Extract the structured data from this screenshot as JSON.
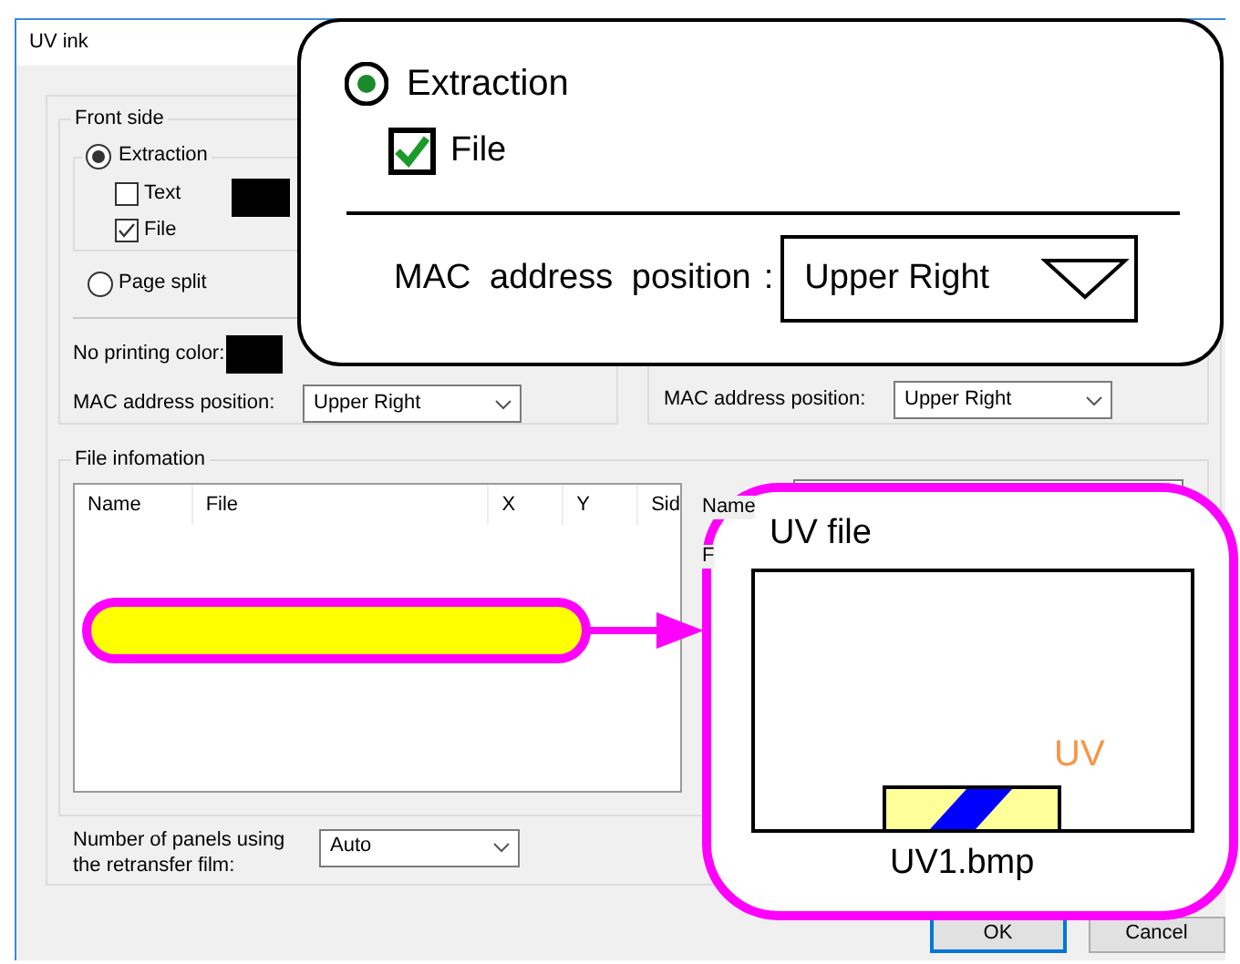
{
  "window": {
    "title": "UV ink"
  },
  "front_side": {
    "title": "Front side",
    "extraction": {
      "label": "Extraction",
      "selected": true
    },
    "options": [
      {
        "label": "Text",
        "checked": false
      },
      {
        "label": "File",
        "checked": true
      }
    ],
    "page_split": {
      "label": "Page split",
      "selected": false
    },
    "no_printing_color": {
      "label": "No printing color:"
    },
    "mac_position": {
      "label": "MAC address position:",
      "value": "Upper Right"
    }
  },
  "back_side": {
    "mac_position": {
      "label": "MAC address position:",
      "value": "Upper Right"
    }
  },
  "file_information": {
    "title": "File infomation",
    "columns": [
      "Name",
      "File",
      "X",
      "Y",
      "Sid"
    ],
    "labels": [
      "Name",
      "F"
    ]
  },
  "panels": {
    "label": "Number of panels using the retransfer film:",
    "value": "Auto"
  },
  "buttons": {
    "ok": "OK",
    "cancel": "Cancel"
  },
  "callout_settings": {
    "extraction": {
      "label": "Extraction",
      "selected": true
    },
    "file": {
      "label": "File",
      "checked": true
    },
    "mac_label": "MAC address position",
    "colon": ":",
    "mac_value": "Upper Right"
  },
  "callout_uv_file": {
    "title": "UV file",
    "uv_label": "UV",
    "file_name": "UV1.bmp"
  }
}
